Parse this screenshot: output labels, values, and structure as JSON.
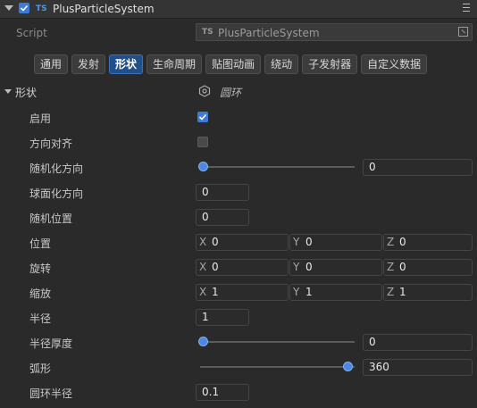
{
  "component": {
    "name": "PlusParticleSystem",
    "enabled": true,
    "ts_badge": "TS"
  },
  "script": {
    "label": "Script",
    "value": "PlusParticleSystem",
    "ts_badge": "TS"
  },
  "tabs": [
    {
      "label": "通用",
      "active": false
    },
    {
      "label": "发射",
      "active": false
    },
    {
      "label": "形状",
      "active": true
    },
    {
      "label": "生命周期",
      "active": false
    },
    {
      "label": "贴图动画",
      "active": false
    },
    {
      "label": "绕动",
      "active": false
    },
    {
      "label": "子发射器",
      "active": false
    },
    {
      "label": "自定义数据",
      "active": false
    }
  ],
  "section": {
    "title": "形状",
    "shape_type": "圆环",
    "shape_icon": "hexagon-icon"
  },
  "fields": {
    "enabled": {
      "label": "启用",
      "checked": true
    },
    "align_dir": {
      "label": "方向对齐",
      "checked": false
    },
    "random_dir": {
      "label": "随机化方向",
      "value": "0",
      "slider_fraction": 0.0
    },
    "spherical_dir": {
      "label": "球面化方向",
      "value": "0"
    },
    "random_pos": {
      "label": "随机位置",
      "value": "0"
    },
    "position": {
      "label": "位置",
      "x_label": "X",
      "x": "0",
      "y_label": "Y",
      "y": "0",
      "z_label": "Z",
      "z": "0"
    },
    "rotation": {
      "label": "旋转",
      "x_label": "X",
      "x": "0",
      "y_label": "Y",
      "y": "0",
      "z_label": "Z",
      "z": "0"
    },
    "scale": {
      "label": "缩放",
      "x_label": "X",
      "x": "1",
      "y_label": "Y",
      "y": "1",
      "z_label": "Z",
      "z": "1"
    },
    "radius": {
      "label": "半径",
      "value": "1"
    },
    "radius_thickness": {
      "label": "半径厚度",
      "value": "0",
      "slider_fraction": 0.0
    },
    "arc": {
      "label": "弧形",
      "value": "360",
      "slider_fraction": 1.0
    },
    "torus_radius": {
      "label": "圆环半径",
      "value": "0.1"
    }
  },
  "colors": {
    "accent": "#3d7cd6",
    "active_tab": "#214f8c"
  }
}
